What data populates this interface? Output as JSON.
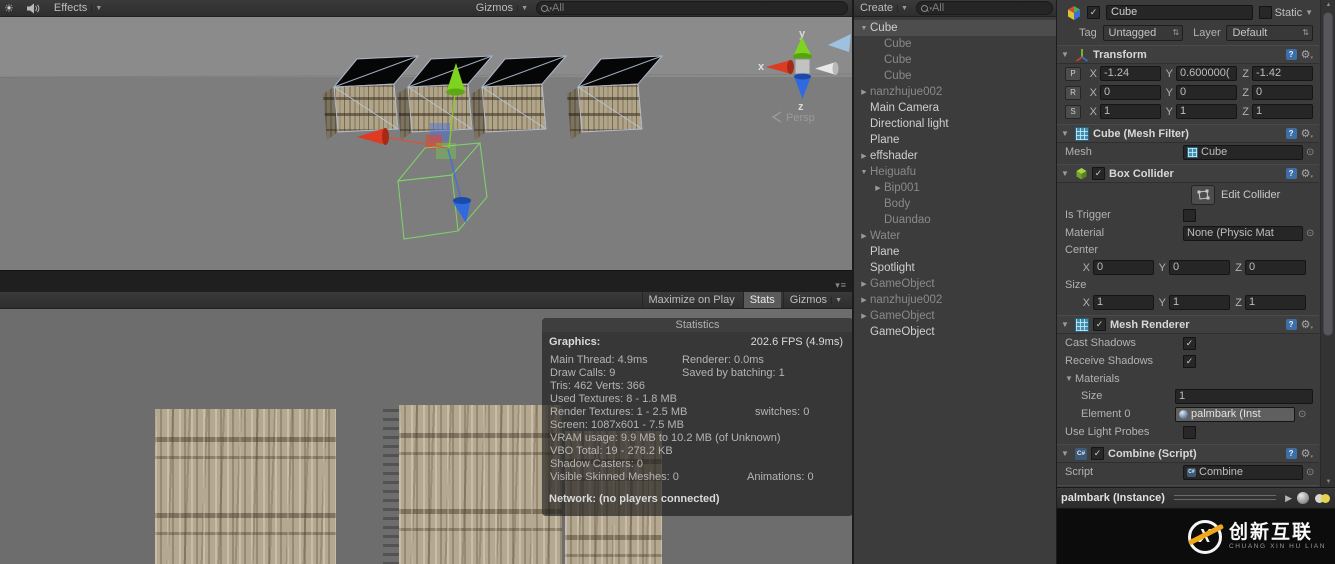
{
  "scene_view": {
    "toolbar": {
      "effects_label": "Effects",
      "gizmos_label": "Gizmos",
      "search_placeholder": "All"
    },
    "gizmo": {
      "x": "x",
      "y": "y",
      "z": "z",
      "persp_label": "Persp"
    }
  },
  "game_view": {
    "toolbar": {
      "maximize_label": "Maximize on Play",
      "stats_label": "Stats",
      "gizmos_label": "Gizmos"
    },
    "statistics": {
      "title": "Statistics",
      "graphics_label": "Graphics:",
      "fps": "202.6 FPS (4.9ms)",
      "rows": [
        {
          "c1": "Main Thread: 4.9ms",
          "c2": "Renderer: 0.0ms",
          "c2x": 140
        },
        {
          "c1": "Draw Calls: 9",
          "c2": "Saved by batching: 1",
          "c2x": 140
        },
        {
          "c1": "Tris: 462 Verts: 366"
        },
        {
          "c1": "Used Textures: 8 - 1.8 MB"
        },
        {
          "c1": "Render Textures: 1 - 2.5 MB",
          "c2": "switches: 0",
          "c2x": 213
        },
        {
          "c1": "Screen: 1087x601 - 7.5 MB"
        },
        {
          "c1": "VRAM usage: 9.9 MB to 10.2 MB (of Unknown)"
        },
        {
          "c1": "VBO Total: 19 - 278.2 KB"
        },
        {
          "c1": "Shadow Casters: 0"
        },
        {
          "c1": "Visible Skinned Meshes: 0",
          "c2": "Animations: 0",
          "c2x": 205
        }
      ],
      "network": "Network: (no players connected)"
    }
  },
  "hierarchy": {
    "create_label": "Create",
    "search_placeholder": "All",
    "items": [
      {
        "label": "Cube",
        "arrow": "expanded",
        "indent": 0,
        "dim": false,
        "selected": true
      },
      {
        "label": "Cube",
        "arrow": "",
        "indent": 1,
        "dim": true
      },
      {
        "label": "Cube",
        "arrow": "",
        "indent": 1,
        "dim": true
      },
      {
        "label": "Cube",
        "arrow": "",
        "indent": 1,
        "dim": true
      },
      {
        "label": "nanzhujue002",
        "arrow": "collapsed",
        "indent": 0,
        "dim": true
      },
      {
        "label": "Main Camera",
        "arrow": "",
        "indent": 0,
        "dim": false
      },
      {
        "label": "Directional light",
        "arrow": "",
        "indent": 0,
        "dim": false
      },
      {
        "label": "Plane",
        "arrow": "",
        "indent": 0,
        "dim": false
      },
      {
        "label": "effshader",
        "arrow": "collapsed",
        "indent": 0,
        "dim": false
      },
      {
        "label": "Heiguafu",
        "arrow": "expanded",
        "indent": 0,
        "dim": true
      },
      {
        "label": "Bip001",
        "arrow": "collapsed",
        "indent": 1,
        "dim": true
      },
      {
        "label": "Body",
        "arrow": "",
        "indent": 1,
        "dim": true
      },
      {
        "label": "Duandao",
        "arrow": "",
        "indent": 1,
        "dim": true
      },
      {
        "label": "Water",
        "arrow": "collapsed",
        "indent": 0,
        "dim": true
      },
      {
        "label": "Plane",
        "arrow": "",
        "indent": 0,
        "dim": false
      },
      {
        "label": "Spotlight",
        "arrow": "",
        "indent": 0,
        "dim": false
      },
      {
        "label": "GameObject",
        "arrow": "collapsed",
        "indent": 0,
        "dim": true
      },
      {
        "label": "nanzhujue002",
        "arrow": "collapsed",
        "indent": 0,
        "dim": true
      },
      {
        "label": "GameObject",
        "arrow": "collapsed",
        "indent": 0,
        "dim": true
      },
      {
        "label": "GameObject",
        "arrow": "",
        "indent": 0,
        "dim": false
      }
    ]
  },
  "inspector": {
    "header": {
      "enabled": true,
      "name": "Cube",
      "static_label": "Static",
      "static_on": false,
      "tag_label": "Tag",
      "tag_value": "Untagged",
      "layer_label": "Layer",
      "layer_value": "Default"
    },
    "transform": {
      "title": "Transform",
      "rows": [
        {
          "k": "P",
          "x": "-1.24",
          "y": "0.600000(",
          "z": "-1.42"
        },
        {
          "k": "R",
          "x": "0",
          "y": "0",
          "z": "0"
        },
        {
          "k": "S",
          "x": "1",
          "y": "1",
          "z": "1"
        }
      ]
    },
    "mesh_filter": {
      "title": "Cube (Mesh Filter)",
      "mesh_label": "Mesh",
      "mesh_value": "Cube"
    },
    "box_collider": {
      "title": "Box Collider",
      "enabled": true,
      "edit_label": "Edit Collider",
      "is_trigger_label": "Is Trigger",
      "is_trigger": false,
      "material_label": "Material",
      "material_value": "None (Physic Mat",
      "center_label": "Center",
      "center": {
        "x": "0",
        "y": "0",
        "z": "0"
      },
      "size_label": "Size",
      "size": {
        "x": "1",
        "y": "1",
        "z": "1"
      }
    },
    "mesh_renderer": {
      "title": "Mesh Renderer",
      "enabled": true,
      "cast_label": "Cast Shadows",
      "cast": true,
      "receive_label": "Receive Shadows",
      "receive": true,
      "materials_label": "Materials",
      "size_label": "Size",
      "size_value": "1",
      "element_label": "Element 0",
      "element_value": "palmbark (Inst",
      "probes_label": "Use Light Probes",
      "probes": false
    },
    "combine": {
      "title": "Combine (Script)",
      "enabled": true,
      "script_label": "Script",
      "script_value": "Combine"
    },
    "preview": {
      "label": "palmbark (Instance)"
    }
  },
  "logo": {
    "cn": "创新互联",
    "en": "CHUANG XIN HU LIAN"
  }
}
